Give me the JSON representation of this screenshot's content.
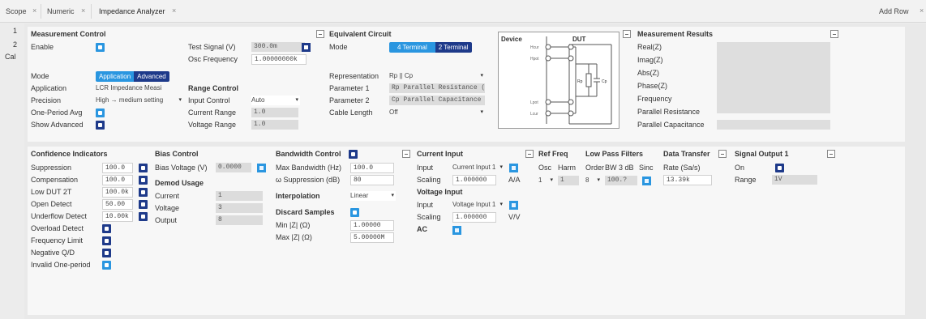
{
  "tabs": [
    {
      "label": "Scope"
    },
    {
      "label": "Numeric"
    },
    {
      "label": "Impedance Analyzer"
    }
  ],
  "add_row": "Add Row",
  "left_strip": [
    "1",
    "2",
    "Cal"
  ],
  "measurement_control": {
    "title": "Measurement Control",
    "enable_label": "Enable",
    "test_signal_label": "Test Signal (V)",
    "test_signal_value": "300.0m",
    "osc_frequency_label": "Osc Frequency",
    "osc_frequency_value": "1.00000000k",
    "mode_label": "Mode",
    "mode_options": [
      "Application",
      "Advanced"
    ],
    "application_label": "Application",
    "application_value": "LCR Impedance Measi",
    "precision_label": "Precision",
    "precision_value": "High → medium setting",
    "one_period_avg_label": "One-Period Avg",
    "show_advanced_label": "Show Advanced"
  },
  "range_control": {
    "title": "Range Control",
    "input_control_label": "Input Control",
    "input_control_value": "Auto",
    "current_range_label": "Current Range",
    "current_range_value": "1.0",
    "voltage_range_label": "Voltage Range",
    "voltage_range_value": "1.0"
  },
  "equivalent_circuit": {
    "title": "Equivalent Circuit",
    "mode_label": "Mode",
    "mode_options": [
      "4 Terminal",
      "2 Terminal"
    ],
    "representation_label": "Representation",
    "representation_value": "Rp || Cp",
    "parameter1_label": "Parameter 1",
    "parameter1_value": "Rp Parallel Resistance (Ω)",
    "parameter2_label": "Parameter 2",
    "parameter2_value": "Cp Parallel Capacitance (F)",
    "cable_length_label": "Cable Length",
    "cable_length_value": "Off"
  },
  "diagram": {
    "device_label": "Device",
    "dut_label": "DUT",
    "terminals": [
      "Hcur",
      "Hpot",
      "Lpot",
      "Lcur"
    ],
    "rp_label": "Rp",
    "cp_label": "Cp"
  },
  "measurement_results": {
    "title": "Measurement Results",
    "items": [
      "Real(Z)",
      "Imag(Z)",
      "Abs(Z)",
      "Phase(Z)",
      "Frequency",
      "Parallel Resistance",
      "Parallel Capacitance"
    ]
  },
  "confidence_indicators": {
    "title": "Confidence Indicators",
    "rows": [
      {
        "label": "Suppression",
        "value": "100.0"
      },
      {
        "label": "Compensation",
        "value": "100.0"
      },
      {
        "label": "Low DUT 2T",
        "value": "100.0k"
      },
      {
        "label": "Open Detect",
        "value": "50.00"
      },
      {
        "label": "Underflow Detect",
        "value": "10.00k"
      }
    ],
    "flags": [
      "Overload Detect",
      "Frequency Limit",
      "Negative Q/D",
      "Invalid One-period"
    ]
  },
  "bias_control": {
    "title": "Bias Control",
    "bias_voltage_label": "Bias Voltage (V)",
    "bias_voltage_value": "0.0000"
  },
  "demod_usage": {
    "title": "Demod Usage",
    "rows": [
      {
        "label": "Current",
        "value": "1"
      },
      {
        "label": "Voltage",
        "value": "3"
      },
      {
        "label": "Output",
        "value": "8"
      }
    ]
  },
  "bandwidth_control": {
    "title": "Bandwidth Control",
    "max_bandwidth_label": "Max Bandwidth (Hz)",
    "max_bandwidth_value": "100.0",
    "omega_suppression_label": "ω Suppression (dB)",
    "omega_suppression_value": "80",
    "interpolation_label": "Interpolation",
    "interpolation_value": "Linear",
    "discard_samples_label": "Discard Samples",
    "min_z_label": "Min |Z| (Ω)",
    "min_z_value": "1.00000",
    "max_z_label": "Max |Z| (Ω)",
    "max_z_value": "5.00000M"
  },
  "current_input": {
    "title": "Current Input",
    "input_label": "Input",
    "input_value": "Current Input 1",
    "scaling_label": "Scaling",
    "scaling_value": "1.000000",
    "scaling_unit": "A/A"
  },
  "voltage_input": {
    "title": "Voltage Input",
    "input_label": "Input",
    "input_value": "Voltage Input 1",
    "scaling_label": "Scaling",
    "scaling_value": "1.000000",
    "scaling_unit": "V/V",
    "ac_label": "AC"
  },
  "ref_freq": {
    "title": "Ref Freq",
    "osc_label": "Osc",
    "harm_label": "Harm",
    "osc_value": "1",
    "harm_value": "1"
  },
  "low_pass_filters": {
    "title": "Low Pass Filters",
    "order_label": "Order",
    "bw_label": "BW 3 dB",
    "sinc_label": "Sinc",
    "order_value": "8",
    "bw_value": "100.?"
  },
  "data_transfer": {
    "title": "Data Transfer",
    "rate_label": "Rate (Sa/s)",
    "rate_value": "13.39k"
  },
  "signal_output": {
    "title": "Signal Output 1",
    "on_label": "On",
    "range_label": "Range",
    "range_value": "1V"
  },
  "colors": {
    "accent": "#2a96e0",
    "dark_accent": "#1e3a8a"
  }
}
